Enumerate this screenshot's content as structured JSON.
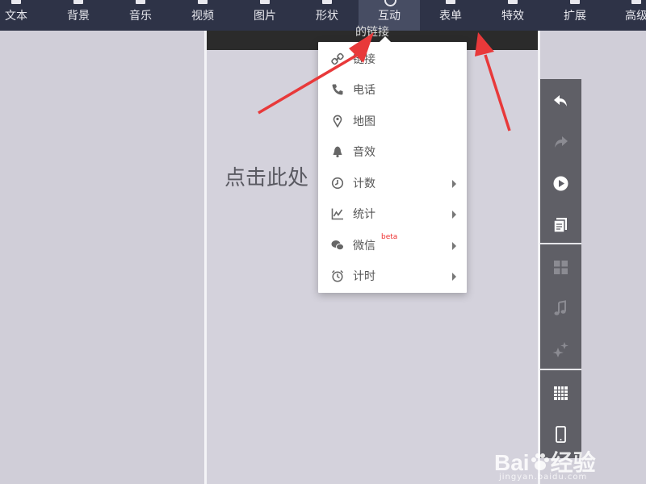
{
  "toolbar": {
    "items": [
      {
        "label": "文本"
      },
      {
        "label": "背景"
      },
      {
        "label": "音乐"
      },
      {
        "label": "视频"
      },
      {
        "label": "图片"
      },
      {
        "label": "形状"
      },
      {
        "label": "互动",
        "active": true
      },
      {
        "label": "表单"
      },
      {
        "label": "特效"
      },
      {
        "label": "扩展"
      },
      {
        "label": "高级"
      }
    ]
  },
  "canvas": {
    "header_text": "的链接",
    "placeholder": "点击此处"
  },
  "dropdown": {
    "items": [
      {
        "label": "链接",
        "icon": "link-icon",
        "submenu": false
      },
      {
        "label": "电话",
        "icon": "phone-icon",
        "submenu": false
      },
      {
        "label": "地图",
        "icon": "map-pin-icon",
        "submenu": false
      },
      {
        "label": "音效",
        "icon": "bell-icon",
        "submenu": false
      },
      {
        "label": "计数",
        "icon": "clock-icon",
        "submenu": true
      },
      {
        "label": "统计",
        "icon": "chart-icon",
        "submenu": true
      },
      {
        "label": "微信",
        "icon": "wechat-icon",
        "submenu": true,
        "badge": "beta"
      },
      {
        "label": "计时",
        "icon": "alarm-clock-icon",
        "submenu": true
      }
    ]
  },
  "sidebar": {
    "buttons": [
      "undo-icon",
      "redo-icon",
      "play-icon",
      "pages-icon",
      "grid-icon",
      "music-note-icon",
      "sparkle-icon",
      "table-icon",
      "mobile-icon"
    ]
  },
  "watermark": {
    "brand": "Bai",
    "brand_suffix": "经验",
    "sub": "jingyan.baidu.com"
  },
  "colors": {
    "toolbar_bg": "#2e3347",
    "toolbar_active": "#474d63",
    "sidebar_bg": "#5f5f66",
    "arrow": "#e8393a",
    "beta": "#e33333"
  }
}
